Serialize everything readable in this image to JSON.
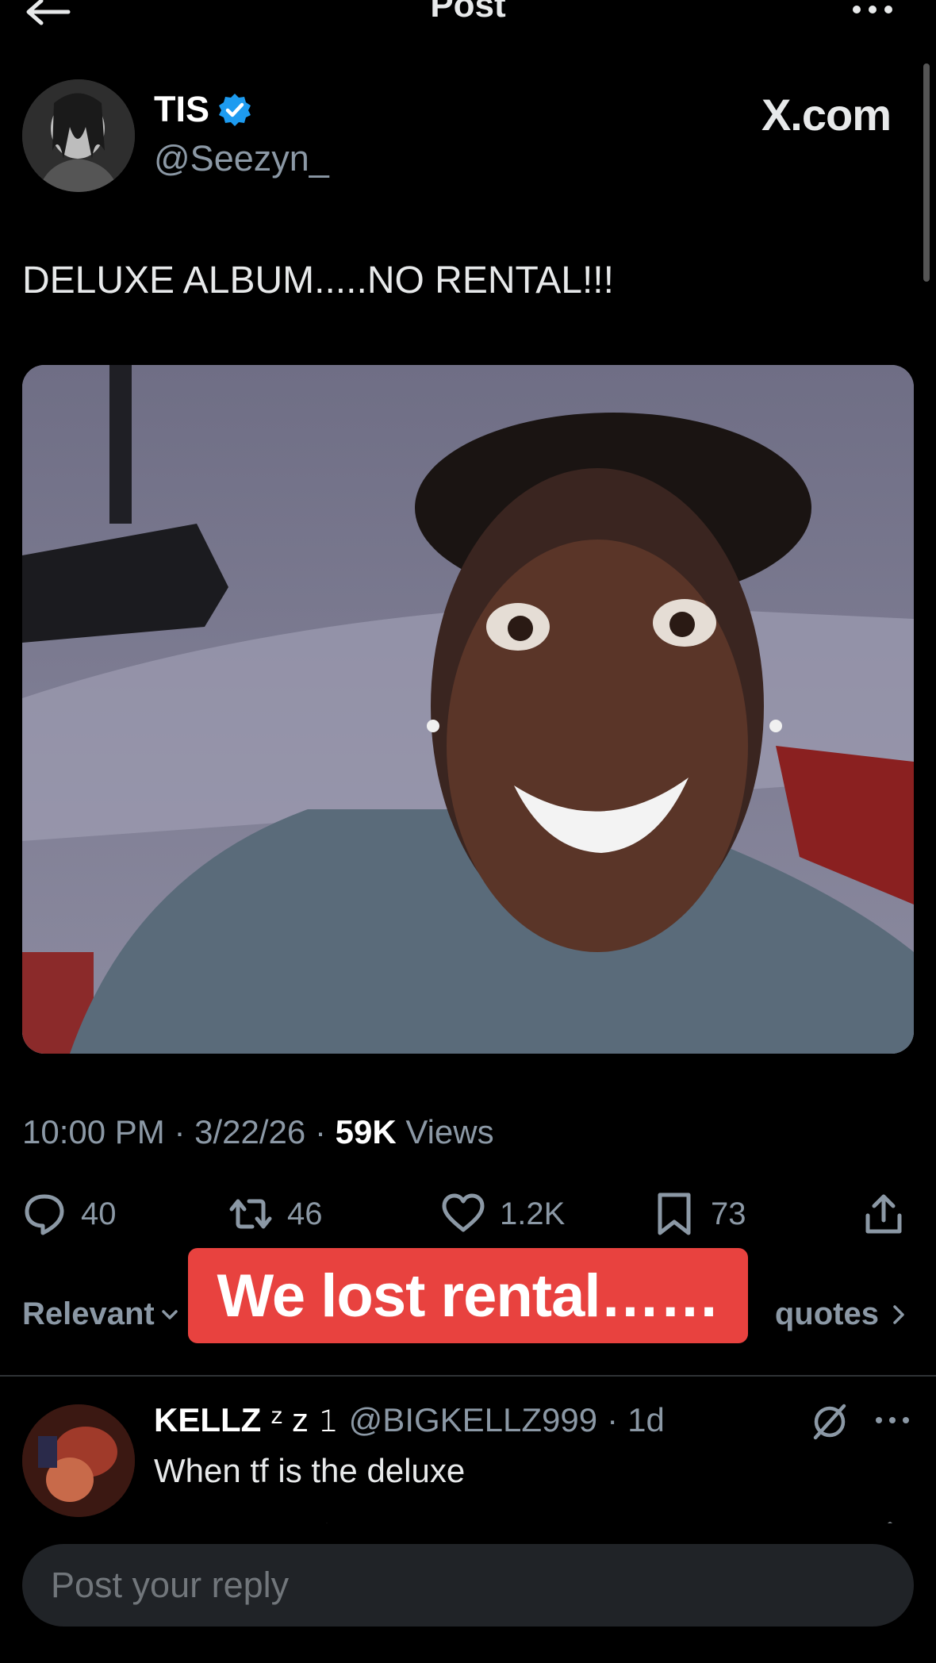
{
  "header": {
    "title": "Post",
    "back_icon": "arrow-left-icon",
    "more_icon": "more-horizontal-icon"
  },
  "author": {
    "name": "TIS",
    "handle": "@Seezyn_",
    "verified_color": "#1d9bf0"
  },
  "watermark": "X.com",
  "post": {
    "text": "DELUXE ALBUM.....NO RENTAL!!!"
  },
  "meta": {
    "time": "10:00 PM",
    "date": "3/22/26",
    "views_count": "59K",
    "views_label": "Views",
    "sep": "·"
  },
  "actions": {
    "replies": "40",
    "reposts": "46",
    "likes": "1.2K",
    "bookmarks": "73"
  },
  "sort": {
    "relevant_label": "Relevant",
    "quotes_label": "quotes"
  },
  "banner": {
    "text": "We lost rental……",
    "color": "#e8423f"
  },
  "reply": {
    "name": "KELLZ",
    "name_suffix": "ᶻ z 𝟷",
    "handle": "@BIGKELLZ999",
    "time": "1d",
    "text": "When tf is the deluxe"
  },
  "compose": {
    "placeholder": "Post your reply"
  },
  "colors": {
    "background": "#000000",
    "secondary_text": "#8b98a5",
    "accent": "#1d9bf0"
  }
}
